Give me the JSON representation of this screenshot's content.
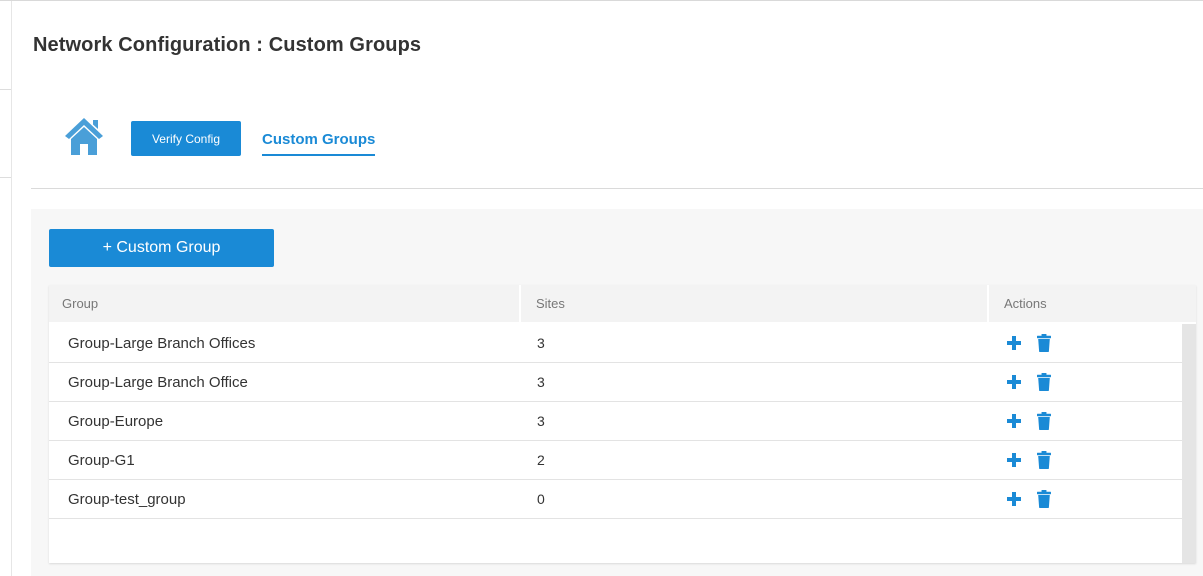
{
  "header": {
    "title": "Network Configuration : Custom Groups"
  },
  "breadcrumb": {
    "home_icon": "home-icon",
    "verify_button": "Verify Config",
    "current": "Custom Groups"
  },
  "toolbar": {
    "add_group_label": "+ Custom Group"
  },
  "table": {
    "columns": [
      "Group",
      "Sites",
      "Actions"
    ],
    "rows": [
      {
        "group": "Group-Large Branch Offices",
        "sites": "3"
      },
      {
        "group": "Group-Large Branch Office",
        "sites": "3"
      },
      {
        "group": "Group-Europe",
        "sites": "3"
      },
      {
        "group": "Group-G1",
        "sites": "2"
      },
      {
        "group": "Group-test_group",
        "sites": "0"
      }
    ],
    "row_actions": [
      "plus-icon",
      "trash-icon"
    ]
  },
  "colors": {
    "accent": "#1a8ad6",
    "text": "#333333",
    "header_bg": "#f3f3f3",
    "panel_bg": "#f7f7f7"
  }
}
